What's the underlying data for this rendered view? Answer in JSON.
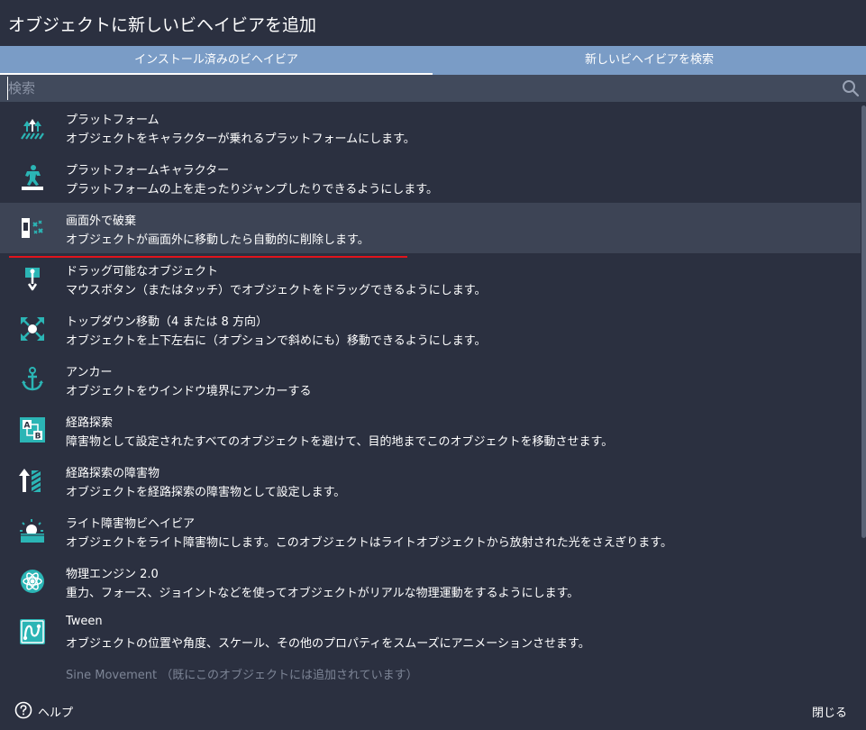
{
  "window": {
    "title": "オブジェクトに新しいビヘイビアを追加"
  },
  "tabs": [
    {
      "label": "インストール済みのビヘイビア",
      "active": true
    },
    {
      "label": "新しいビヘイビアを検索",
      "active": false
    }
  ],
  "search": {
    "placeholder": "検索",
    "value": ""
  },
  "behaviors": [
    {
      "name": "プラットフォーム",
      "description": "オブジェクトをキャラクターが乗れるプラットフォームにします。",
      "icon": "platform-icon"
    },
    {
      "name": "プラットフォームキャラクター",
      "description": "プラットフォームの上を走ったりジャンプしたりできるようにします。",
      "icon": "platformer-character-icon"
    },
    {
      "name": "画面外で破棄",
      "description": "オブジェクトが画面外に移動したら自動的に削除します。",
      "icon": "destroy-outside-screen-icon"
    },
    {
      "name": "ドラッグ可能なオブジェクト",
      "description": "マウスボタン（またはタッチ）でオブジェクトをドラッグできるようにします。",
      "icon": "draggable-icon"
    },
    {
      "name": "トップダウン移動（4 または 8 方向）",
      "description": "オブジェクトを上下左右に（オプションで斜めにも）移動できるようにします。",
      "icon": "top-down-movement-icon"
    },
    {
      "name": "アンカー",
      "description": "オブジェクトをウインドウ境界にアンカーする",
      "icon": "anchor-icon"
    },
    {
      "name": "経路探索",
      "description": "障害物として設定されたすべてのオブジェクトを避けて、目的地までこのオブジェクトを移動させます。",
      "icon": "pathfinding-icon"
    },
    {
      "name": "経路探索の障害物",
      "description": "オブジェクトを経路探索の障害物として設定します。",
      "icon": "pathfinding-obstacle-icon"
    },
    {
      "name": "ライト障害物ビヘイビア",
      "description": "オブジェクトをライト障害物にします。このオブジェクトはライトオブジェクトから放射された光をさえぎります。",
      "icon": "light-obstacle-icon"
    },
    {
      "name": "物理エンジン 2.0",
      "description": "重力、フォース、ジョイントなどを使ってオブジェクトがリアルな物理運動をするようにします。",
      "icon": "physics-engine-icon"
    },
    {
      "name": "Tween",
      "description": "オブジェクトの位置や角度、スケール、その他のプロパティをスムーズにアニメーションさせます。",
      "icon": "tween-icon"
    },
    {
      "name": "Sine Movement （既にこのオブジェクトには追加されています）",
      "description": "",
      "icon": "sine-movement-icon"
    }
  ],
  "footer": {
    "help_label": "ヘルプ",
    "close_label": "閉じる"
  },
  "colors": {
    "background": "#2b3040",
    "tab_bar": "#7a9cc6",
    "search_bg": "#414a5c",
    "selected_row": "#3d4455",
    "icon_teal": "#2bb5b5",
    "annotation_red": "#e0141c"
  }
}
